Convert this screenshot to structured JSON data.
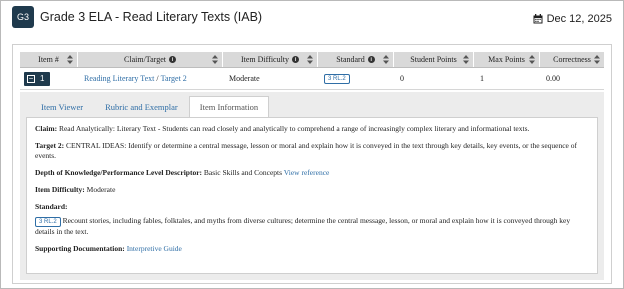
{
  "header": {
    "badge": "G3",
    "title": "Grade 3 ELA - Read Literary Texts (IAB)",
    "date": "Dec 12, 2025"
  },
  "table": {
    "columns": [
      "Item #",
      "Claim/Target",
      "Item Difficulty",
      "Standard",
      "Student Points",
      "Max Points",
      "Correctness"
    ],
    "row": {
      "item": "1",
      "claim": "Reading Literary Text",
      "sep": " / ",
      "target": "Target 2",
      "difficulty": "Moderate",
      "standard": "3 RL.2",
      "student_points": "0",
      "max_points": "1",
      "correctness": "0.00"
    }
  },
  "tabs": [
    "Item Viewer",
    "Rubric and Exemplar",
    "Item Information"
  ],
  "info": {
    "claim_label": "Claim:",
    "claim_text": " Read Analytically: Literary Text - Students can read closely and analytically to comprehend a range of increasingly complex literary and informational texts.",
    "target_label": "Target 2:",
    "target_text": " CENTRAL IDEAS: Identify or determine a central message, lesson or moral and explain how it is conveyed in the text through key details, key events, or the sequence of events.",
    "dok_label": "Depth of Knowledge/Performance Level Descriptor:",
    "dok_text": " Basic Skills and Concepts ",
    "dok_link": "View reference",
    "difficulty_label": "Item Difficulty:",
    "difficulty_text": " Moderate",
    "standard_label": "Standard:",
    "standard_badge": "3 RL.2",
    "standard_text": " Recount stories, including fables, folktales, and myths from diverse cultures; determine the central message, lesson, or moral and explain how it is conveyed through key details in the text.",
    "docs_label": "Supporting Documentation:",
    "docs_link": "Interpretive Guide"
  },
  "colors": {
    "navy": "#1f3a4d",
    "link": "#2f6ea6",
    "header_bg": "#d9d9d9",
    "detail_bg": "#ececec"
  }
}
